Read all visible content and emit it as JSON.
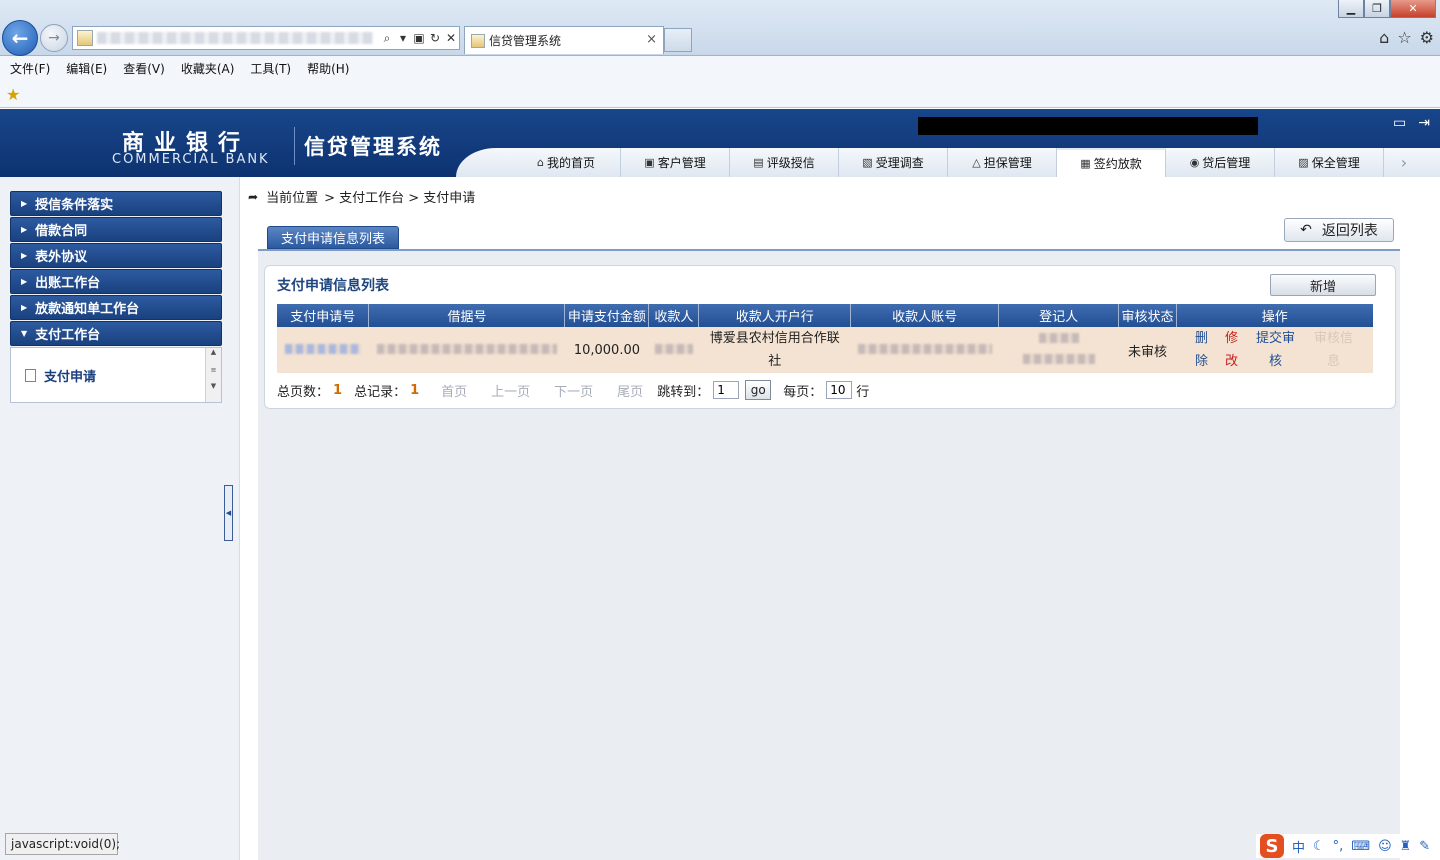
{
  "browser": {
    "tab_title": "信贷管理系统",
    "tab_close": "×",
    "menu": [
      "文件(F)",
      "编辑(E)",
      "查看(V)",
      "收藏夹(A)",
      "工具(T)",
      "帮助(H)"
    ]
  },
  "header": {
    "bank_name_cn": "商业银行",
    "bank_name_en": "COMMERCIAL BANK",
    "system_name": "信贷管理系统"
  },
  "nav": {
    "tabs": [
      "我的首页",
      "客户管理",
      "评级授信",
      "受理调查",
      "担保管理",
      "签约放款",
      "贷后管理",
      "保全管理"
    ],
    "active": "签约放款"
  },
  "sidebar": {
    "items": [
      "授信条件落实",
      "借款合同",
      "表外协议",
      "出账工作台",
      "放款通知单工作台",
      "支付工作台"
    ],
    "sub_item": "支付申请"
  },
  "breadcrumb": {
    "label": "当前位置",
    "path": "> 支付工作台 > 支付申请"
  },
  "panel": {
    "tab": "支付申请信息列表",
    "return_button": "返回列表",
    "title": "支付申请信息列表",
    "add_button": "新增"
  },
  "table": {
    "columns": [
      "支付申请号",
      "借据号",
      "申请支付金额",
      "收款人",
      "收款人开户行",
      "收款人账号",
      "登记人",
      "审核状态",
      "操作"
    ],
    "rows": [
      {
        "amount": "10,000.00",
        "bank": "博爱县农村信用合作联社",
        "status": "未审核",
        "op_delete": "删除",
        "op_edit": "修改",
        "op_submit": "提交审核",
        "op_view": "审核信息"
      }
    ]
  },
  "pager": {
    "total_pages_label": "总页数：",
    "total_pages": "1",
    "total_records_label": "总记录：",
    "total_records": "1",
    "first": "首页",
    "prev": "上一页",
    "next": "下一页",
    "last": "尾页",
    "jump_label": "跳转到：",
    "jump_value": "1",
    "go": "go",
    "per_page_label": "每页：",
    "per_page": "10",
    "rows_unit": "行"
  },
  "status_bar": {
    "text": "javascript:void(0);"
  },
  "ime": {
    "logo": "S",
    "mode": "中"
  }
}
